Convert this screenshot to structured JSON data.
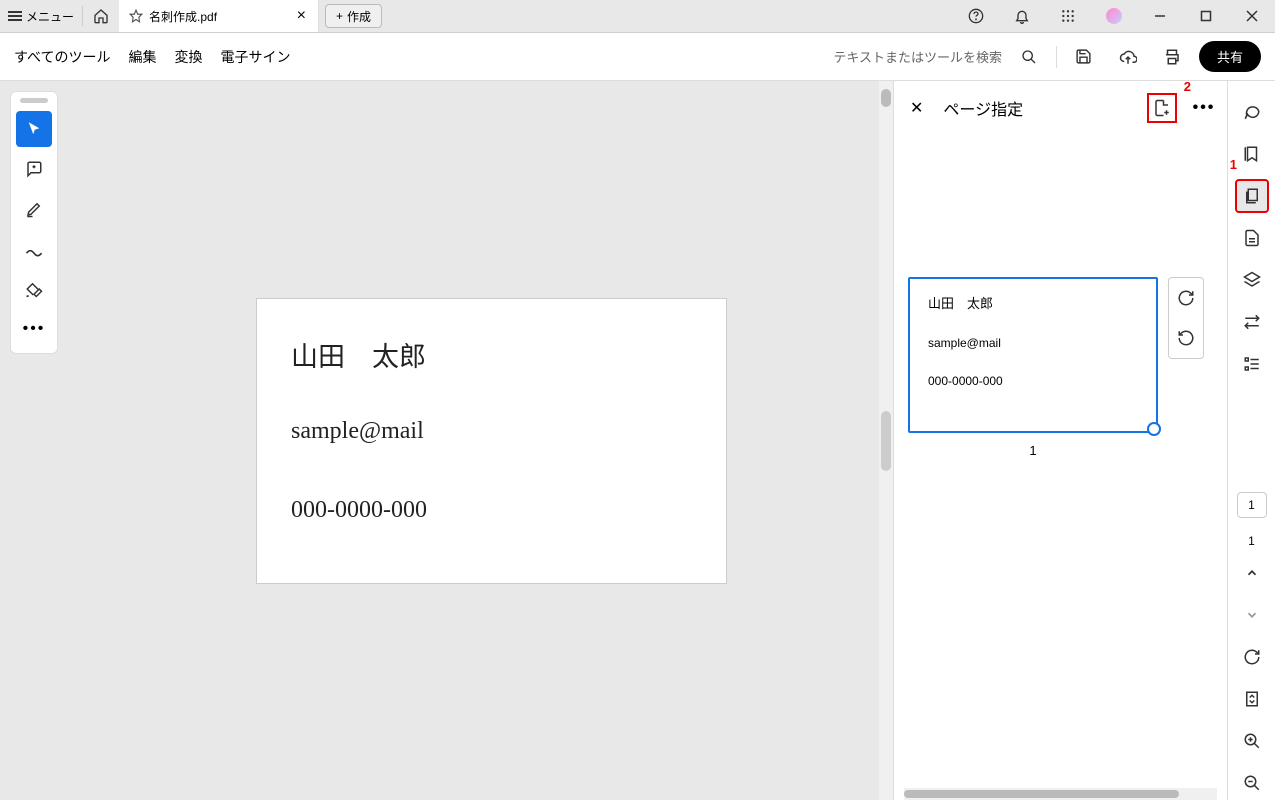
{
  "titlebar": {
    "menu_label": "メニュー",
    "tab_title": "名刺作成.pdf",
    "create_label": "作成"
  },
  "toolbar": {
    "all_tools": "すべてのツール",
    "edit": "編集",
    "convert": "変換",
    "esign": "電子サイン",
    "search_placeholder": "テキストまたはツールを検索",
    "share": "共有"
  },
  "document": {
    "name": "山田　太郎",
    "email": "sample@mail",
    "phone": "000-0000-000"
  },
  "panel": {
    "title": "ページ指定",
    "thumb": {
      "name": "山田　太郎",
      "email": "sample@mail",
      "phone": "000-0000-000",
      "page_num": "1"
    }
  },
  "rail": {
    "current_page": "1",
    "total_pages": "1"
  },
  "annotations": {
    "n1": "1",
    "n2": "2"
  }
}
